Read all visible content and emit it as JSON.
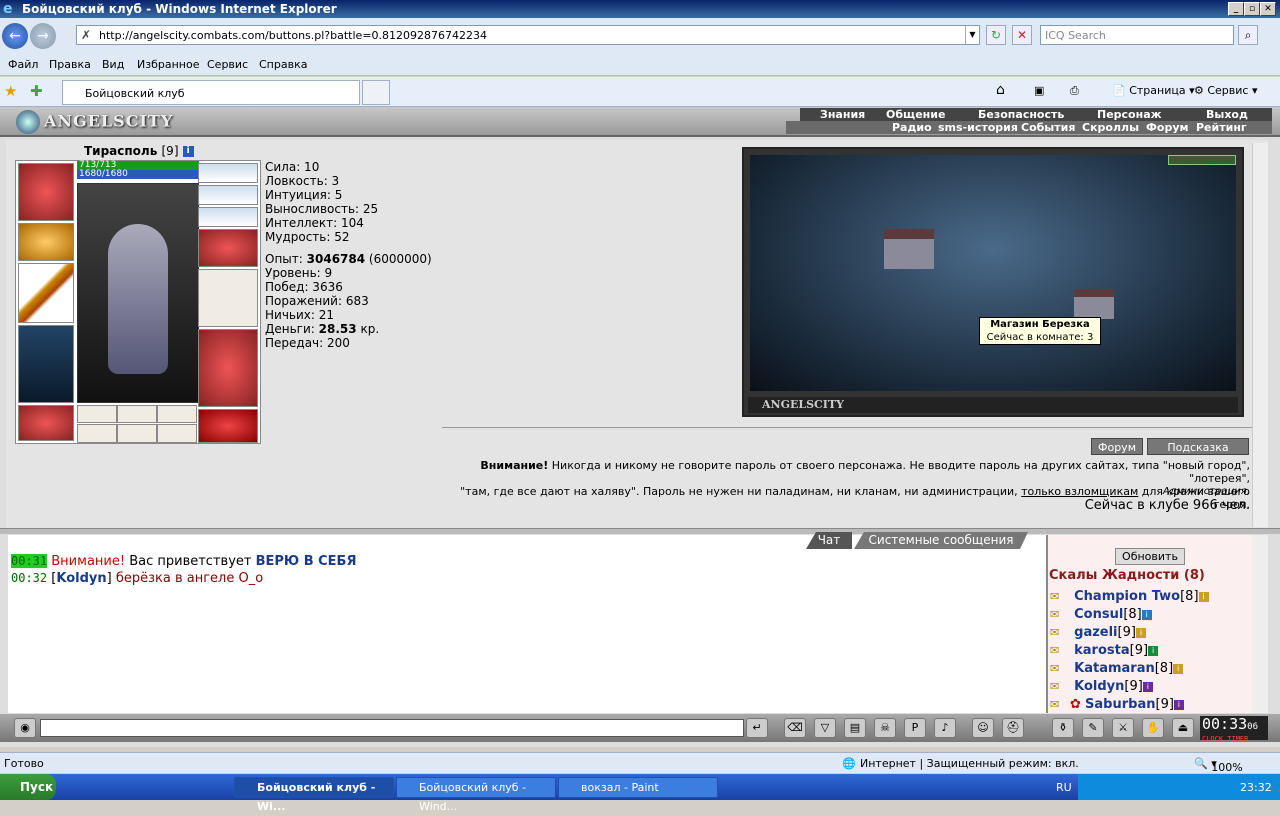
{
  "window": {
    "title": "Бойцовский клуб - Windows Internet Explorer"
  },
  "address": {
    "url": "http://angelscity.combats.com/buttons.pl?battle=0.812092876742234",
    "search_placeholder": "ICQ Search"
  },
  "menu": [
    "Файл",
    "Правка",
    "Вид",
    "Избранное",
    "Сервис",
    "Справка"
  ],
  "tab": {
    "label": "Бойцовский клуб"
  },
  "toolbar": {
    "page": "Страница",
    "service": "Сервис"
  },
  "game": {
    "logo": "ANGELSCITY",
    "top_menu": [
      "Знания",
      "Общение",
      "Безопасность",
      "Персонаж",
      "Выход"
    ],
    "sub_menu": [
      "Радио",
      "sms-история",
      "События",
      "Скроллы",
      "Форум",
      "Рейтинг"
    ],
    "character": {
      "name": "Тирасполь",
      "level": "[9]",
      "hp": "713/713",
      "mp": "1680/1680"
    },
    "stats": [
      "Сила: 10",
      "Ловкость: 3",
      "Интуиция: 5",
      "Выносливость: 25",
      "Интеллект: 104",
      "Мудрость: 52"
    ],
    "exp_label": "Опыт:",
    "exp_value": "3046784",
    "exp_next": "(6000000)",
    "level_line": "Уровень: 9",
    "wins": "Побед: 3636",
    "losses": "Поражений: 683",
    "draws": "Ничьих: 21",
    "money_label": "Деньги:",
    "money_value": "28.53",
    "money_unit": "кр.",
    "transfers": "Передач: 200",
    "scene_caption": "ANGELSCITY",
    "tooltip_title": "Магазин Березка",
    "tooltip_sub": "Сейчас в комнате: 3",
    "btn_forum": "Форум",
    "btn_hint": "Подсказка",
    "warning_bold": "Внимание!",
    "warning_text_1": " Никогда и никому не говорите пароль от своего персонажа. Не вводите пароль на других сайтах, типа \"новый город\", \"лотерея\",",
    "warning_text_2": "\"там, где все дают на халяву\". Пароль не нужен ни паладинам, ни кланам, ни администрации, ",
    "warning_link": "только взломщикам",
    "warning_text_3": " для кражи вашего героя.",
    "admin_sign": "Администрация.",
    "online": "Сейчас в клубе 966 чел.",
    "chat_tab": "Чат",
    "sys_tab": "Системные сообщения",
    "chat": [
      {
        "time": "00:31",
        "prefix": "Внимание!",
        "text": " Вас приветствует ",
        "bold": "ВЕРЮ В СЕБЯ"
      },
      {
        "time": "00:32",
        "nick": "Koldyn",
        "text": " берёзка в ангеле О_о"
      }
    ],
    "refresh": "Обновить",
    "room": "Скалы Жадности (8)",
    "users": [
      {
        "name": "Champion Two",
        "lvl": "[8]",
        "badge": "#c9a020"
      },
      {
        "name": "Consul",
        "lvl": "[8]",
        "badge": "#2a7ab8"
      },
      {
        "name": "gazeli",
        "lvl": "[9]",
        "badge": "#c9a020"
      },
      {
        "name": "karosta",
        "lvl": "[9]",
        "badge": "#1a8a3a"
      },
      {
        "name": "Katamaran",
        "lvl": "[8]",
        "badge": "#c9a020"
      },
      {
        "name": "Koldyn",
        "lvl": "[9]",
        "badge": "#6a2a9a"
      },
      {
        "name": "Saburban",
        "lvl": "[9]",
        "badge": "#6a2a9a"
      }
    ],
    "clock": "00:33",
    "clock_sec": "06",
    "clock_label": "CLOCK TIMER"
  },
  "status": {
    "left": "Готово",
    "zone": "Интернет | Защищенный режим: вкл.",
    "zoom": "100%"
  },
  "taskbar": {
    "start": "Пуск",
    "tasks": [
      "Бойцовский клуб - Wi...",
      "Бойцовский клуб - Wind...",
      "вокзал - Paint"
    ],
    "lang": "RU",
    "time": "23:32"
  }
}
